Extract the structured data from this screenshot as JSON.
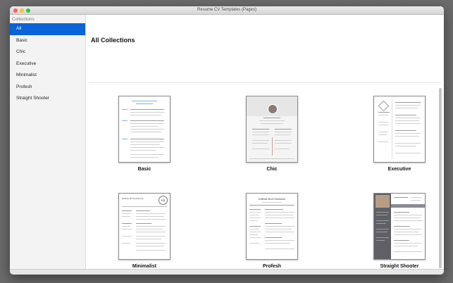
{
  "window": {
    "title": "Resume CV Templates (Pages)"
  },
  "sidebar": {
    "header": "Collections",
    "items": [
      {
        "label": "All",
        "selected": true
      },
      {
        "label": "Basic"
      },
      {
        "label": "Chic"
      },
      {
        "label": "Executive"
      },
      {
        "label": "Minimalist"
      },
      {
        "label": "Profesh"
      },
      {
        "label": "Straight Shooter"
      }
    ]
  },
  "main": {
    "title": "All Collections",
    "templates": [
      {
        "label": "Basic"
      },
      {
        "label": "Chic"
      },
      {
        "label": "Executive"
      },
      {
        "label": "Minimalist",
        "preview_initials": "EB",
        "preview_name": "EMMA BUCHANAN"
      },
      {
        "label": "Profesh",
        "preview_name": "EMMA BUCHANAN"
      },
      {
        "label": "Straight Shooter"
      }
    ]
  },
  "colors": {
    "accent": "#0a63d8",
    "sidebar_bg": "#f3f3f3",
    "desktop": "#6b6b6b"
  }
}
